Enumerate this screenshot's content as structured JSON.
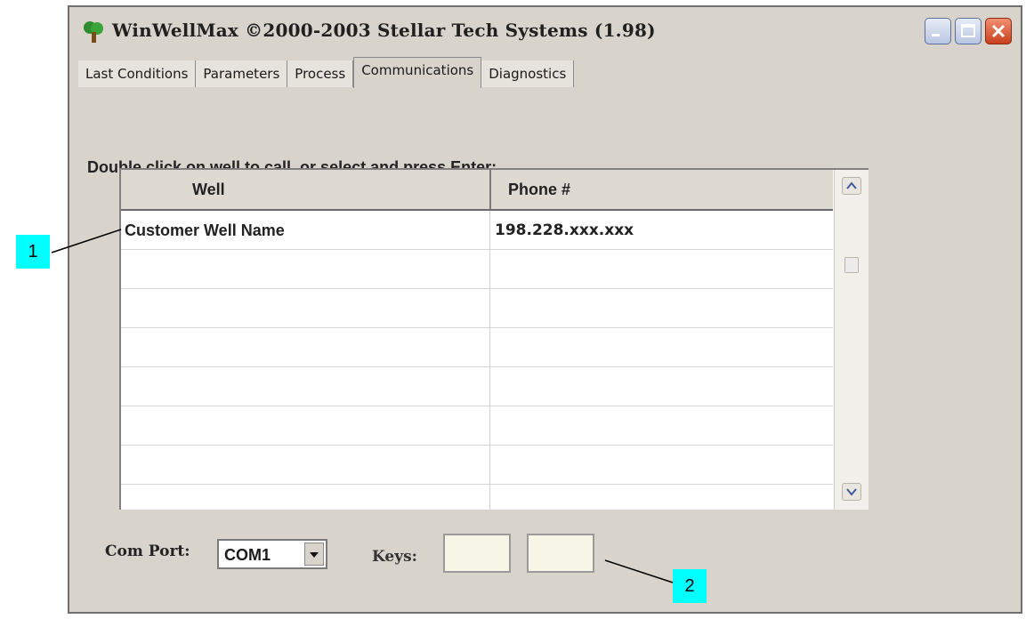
{
  "window": {
    "title": "WinWellMax   ©2000-2003 Stellar Tech Systems (1.98)",
    "icons": {
      "app": "tree-app-icon",
      "minimize": "minimize-icon",
      "maximize": "maximize-icon",
      "close": "close-icon"
    }
  },
  "tabs": [
    {
      "label": "Last Conditions",
      "active": false
    },
    {
      "label": "Parameters",
      "active": false
    },
    {
      "label": "Process",
      "active": false
    },
    {
      "label": "Communications",
      "active": true
    },
    {
      "label": "Diagnostics",
      "active": false
    }
  ],
  "main": {
    "instruction": "Double click on well to call, or select and press Enter:",
    "table": {
      "columns": [
        "Well",
        "Phone #"
      ],
      "rows": [
        {
          "well": "Customer Well Name",
          "phone": "198.228.xxx.xxx"
        },
        {
          "well": "",
          "phone": ""
        },
        {
          "well": "",
          "phone": ""
        },
        {
          "well": "",
          "phone": ""
        },
        {
          "well": "",
          "phone": ""
        },
        {
          "well": "",
          "phone": ""
        },
        {
          "well": "",
          "phone": ""
        },
        {
          "well": "",
          "phone": ""
        }
      ]
    },
    "com_port": {
      "label": "Com Port:",
      "value": "COM1"
    },
    "keys": {
      "label": "Keys:",
      "key1": "",
      "key2": ""
    }
  },
  "annotations": [
    {
      "label": "1"
    },
    {
      "label": "2"
    }
  ],
  "colors": {
    "window_bg": "#d8d4cc",
    "callout": "#00ffff",
    "close_button": "#d9532b"
  }
}
